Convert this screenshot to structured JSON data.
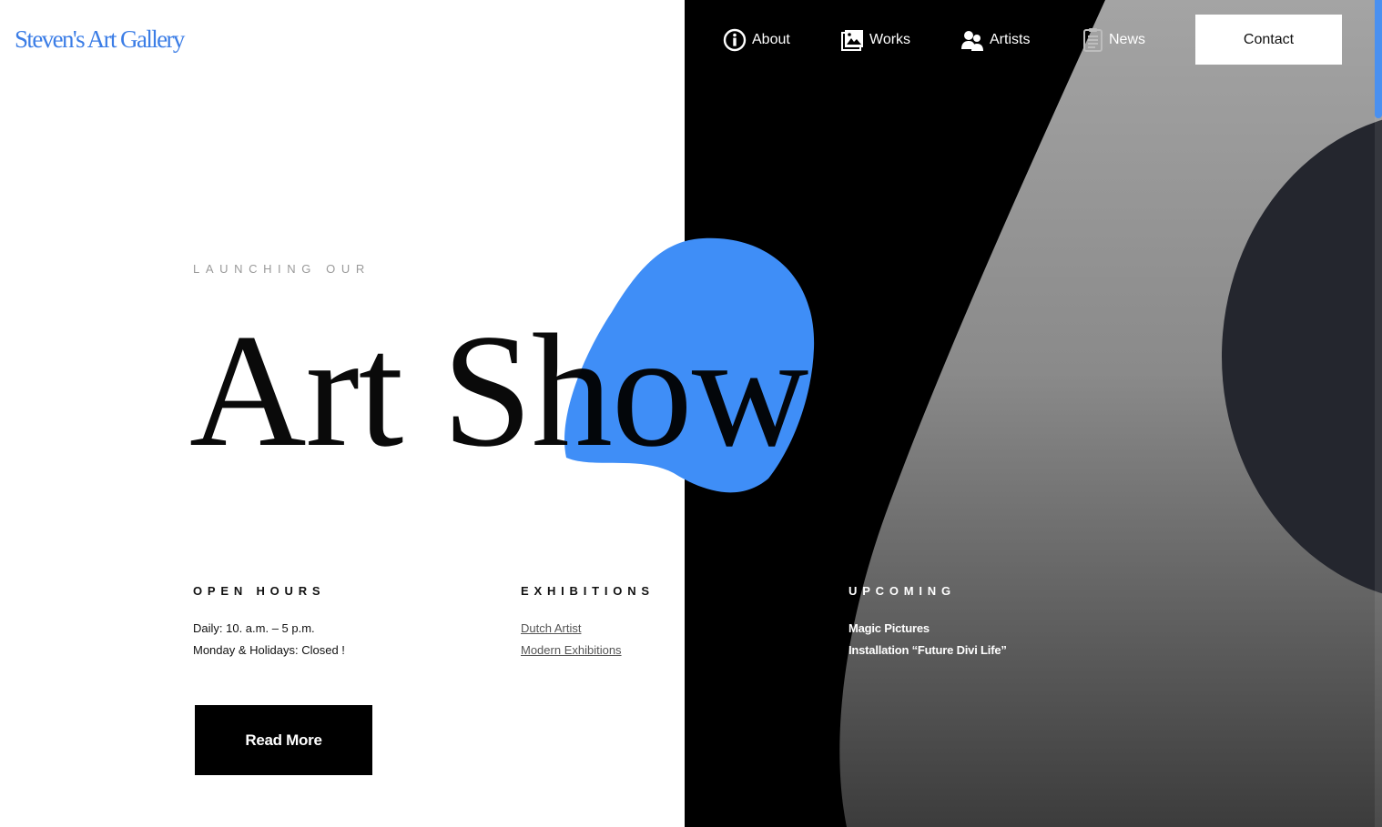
{
  "logo": {
    "text": "Steven's Art Gallery"
  },
  "nav": {
    "items": [
      {
        "label": "About",
        "icon": "info-circle-icon"
      },
      {
        "label": "Works",
        "icon": "image-gallery-icon"
      },
      {
        "label": "Artists",
        "icon": "users-icon"
      },
      {
        "label": "News",
        "icon": "document-icon"
      }
    ],
    "contact_label": "Contact"
  },
  "hero": {
    "eyebrow": "LAUNCHING OUR",
    "title": "Art Show"
  },
  "info": {
    "open_hours": {
      "heading": "OPEN HOURS",
      "lines": [
        "Daily: 10. a.m. – 5 p.m.",
        "Monday & Holidays: Closed !"
      ]
    },
    "exhibitions": {
      "heading": "EXHIBITIONS",
      "links": [
        "Dutch Artist",
        "Modern Exhibitions"
      ]
    },
    "upcoming": {
      "heading": "UPCOMING",
      "lines": [
        "Magic Pictures",
        "Installation “Future Divi Life”"
      ]
    }
  },
  "cta": {
    "read_more_label": "Read More"
  },
  "colors": {
    "accent_blue": "#3f8ef7",
    "logo_blue": "#3b7de6",
    "dark_panel": "#000000",
    "shape_gray": "#8a8a8a",
    "shape_dark": "#24262e"
  }
}
